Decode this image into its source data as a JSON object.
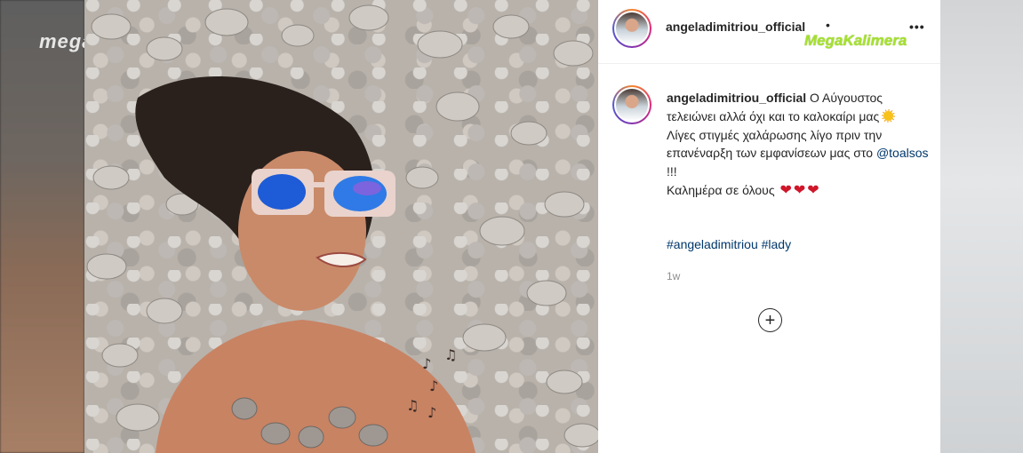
{
  "channel": {
    "logo_text": "mega"
  },
  "watermark": {
    "text": "MegaKalimera"
  },
  "post": {
    "username": "angeladimitriou_official",
    "header_separator": "•",
    "more_icon": "more-options-icon",
    "caption": {
      "username": "angeladimitriou_official",
      "line1": "Ο Αύγουστος τελειώνει αλλά όχι και το καλοκαίρι μας",
      "line2": "Λίγες στιγμές χαλάρωσης λίγο πριν την επανέναρξη των εμφανίσεων μας στο",
      "mention": "@toalsos",
      "line2_end": " !!!",
      "line3": "Καλημέρα σε όλους",
      "emoji_sun": "sun-icon",
      "emoji_hearts": [
        "❤",
        "❤",
        "❤"
      ]
    },
    "hashtags": "#angeladimitriou #lady",
    "timestamp": "1w",
    "load_more_icon": "plus-circle-icon"
  },
  "colors": {
    "username": "#262626",
    "link": "#00376b",
    "muted": "#8e8e8e",
    "watermark": "#a6e22e",
    "heart": "#d0162a"
  }
}
